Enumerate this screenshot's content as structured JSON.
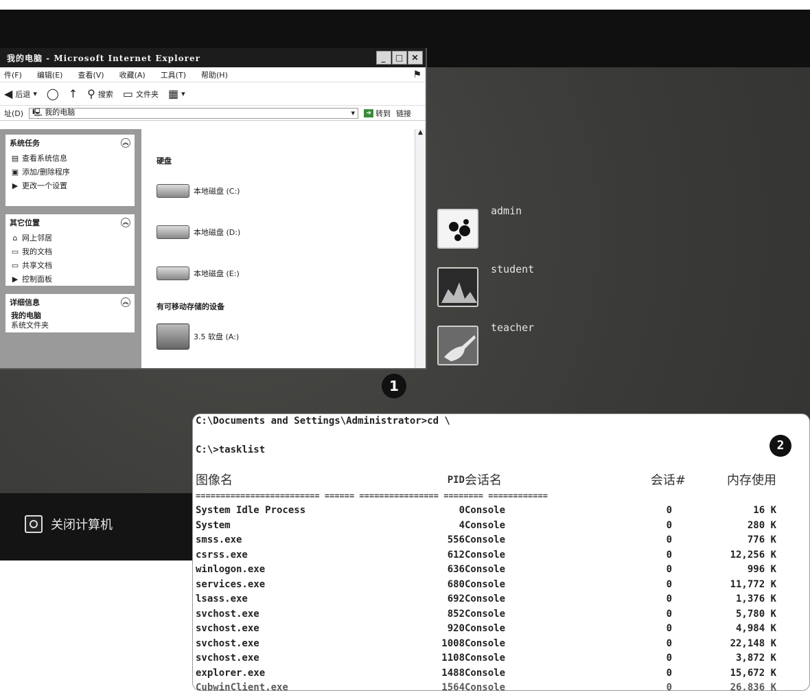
{
  "login": {
    "users": [
      "admin",
      "student",
      "teacher"
    ],
    "shutdown_label": "关闭计算机"
  },
  "ie": {
    "title": "我的电脑 - Microsoft Internet Explorer",
    "menu": [
      "件(F)",
      "编辑(E)",
      "查看(V)",
      "收藏(A)",
      "工具(T)",
      "帮助(H)"
    ],
    "toolbar": {
      "back": "后退",
      "search": "搜索",
      "folders": "文件夹"
    },
    "address": {
      "label": "址(D)",
      "value": "我的电脑",
      "go": "转到",
      "links": "链接"
    },
    "panels": {
      "tasks": {
        "title": "系统任务",
        "items": [
          "查看系统信息",
          "添加/删除程序",
          "更改一个设置"
        ]
      },
      "places": {
        "title": "其它位置",
        "items": [
          "网上邻居",
          "我的文档",
          "共享文档",
          "控制面板"
        ]
      },
      "details": {
        "title": "详细信息",
        "name": "我的电脑",
        "type": "系统文件夹"
      }
    },
    "groups": {
      "hdd": "硬盘",
      "removable": "有可移动存储的设备"
    },
    "drives": [
      "本地磁盘 (C:)",
      "本地磁盘 (D:)",
      "本地磁盘 (E:)"
    ],
    "floppy": "3.5 软盘 (A:)"
  },
  "badges": {
    "one": "1",
    "two": "2"
  },
  "console": {
    "cd_line": "C:\\Documents and Settings\\Administrator>cd \\",
    "cmd_line": "C:\\>tasklist",
    "headers": {
      "name": "图像名",
      "pid": "PID",
      "session_name": "会话名",
      "session_num": "会话#",
      "mem": "内存使用"
    },
    "separator": "========================= ====== ================ ======== ============",
    "rows": [
      {
        "name": "System Idle Process",
        "pid": "0",
        "session": "Console",
        "num": "0",
        "mem": "16 K"
      },
      {
        "name": "System",
        "pid": "4",
        "session": "Console",
        "num": "0",
        "mem": "280 K"
      },
      {
        "name": "smss.exe",
        "pid": "556",
        "session": "Console",
        "num": "0",
        "mem": "776 K"
      },
      {
        "name": "csrss.exe",
        "pid": "612",
        "session": "Console",
        "num": "0",
        "mem": "12,256 K"
      },
      {
        "name": "winlogon.exe",
        "pid": "636",
        "session": "Console",
        "num": "0",
        "mem": "996 K"
      },
      {
        "name": "services.exe",
        "pid": "680",
        "session": "Console",
        "num": "0",
        "mem": "11,772 K"
      },
      {
        "name": "lsass.exe",
        "pid": "692",
        "session": "Console",
        "num": "0",
        "mem": "1,376 K"
      },
      {
        "name": "svchost.exe",
        "pid": "852",
        "session": "Console",
        "num": "0",
        "mem": "5,780 K"
      },
      {
        "name": "svchost.exe",
        "pid": "920",
        "session": "Console",
        "num": "0",
        "mem": "4,984 K"
      },
      {
        "name": "svchost.exe",
        "pid": "1008",
        "session": "Console",
        "num": "0",
        "mem": "22,148 K"
      },
      {
        "name": "svchost.exe",
        "pid": "1108",
        "session": "Console",
        "num": "0",
        "mem": "3,872 K"
      },
      {
        "name": "explorer.exe",
        "pid": "1488",
        "session": "Console",
        "num": "0",
        "mem": "15,672 K"
      },
      {
        "name": "CubwinClient.exe",
        "pid": "1564",
        "session": "Console",
        "num": "0",
        "mem": "26,836 K"
      }
    ]
  }
}
